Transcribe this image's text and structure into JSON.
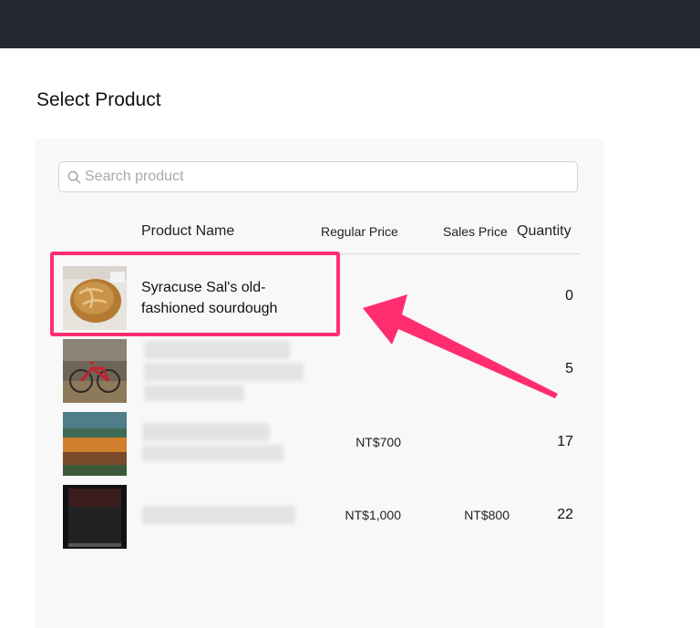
{
  "header": {
    "color": "#242833"
  },
  "page": {
    "title": "Select Product"
  },
  "search": {
    "placeholder": "Search product",
    "icon": "search-icon"
  },
  "table": {
    "columns": [
      "Product Name",
      "Regular Price",
      "Sales Price",
      "Quantity"
    ],
    "rows": [
      {
        "name": "Syracuse Sal's old-fashioned sourdough",
        "name_line1": "Syracuse Sal's old-",
        "name_line2": "fashioned sourdough",
        "regular_price": "",
        "sales_price": "",
        "quantity": "0",
        "thumbnail": "bread-image"
      },
      {
        "name": "",
        "regular_price": "",
        "sales_price": "",
        "quantity": "5",
        "thumbnail": "bicycle-image"
      },
      {
        "name": "",
        "regular_price": "NT$700",
        "sales_price": "",
        "quantity": "17",
        "thumbnail": "colorful-product-image"
      },
      {
        "name": "",
        "regular_price": "NT$1,000",
        "sales_price": "NT$800",
        "quantity": "22",
        "thumbnail": "dark-product-image"
      }
    ]
  },
  "annotation": {
    "highlight_color": "#ff2d6f"
  }
}
